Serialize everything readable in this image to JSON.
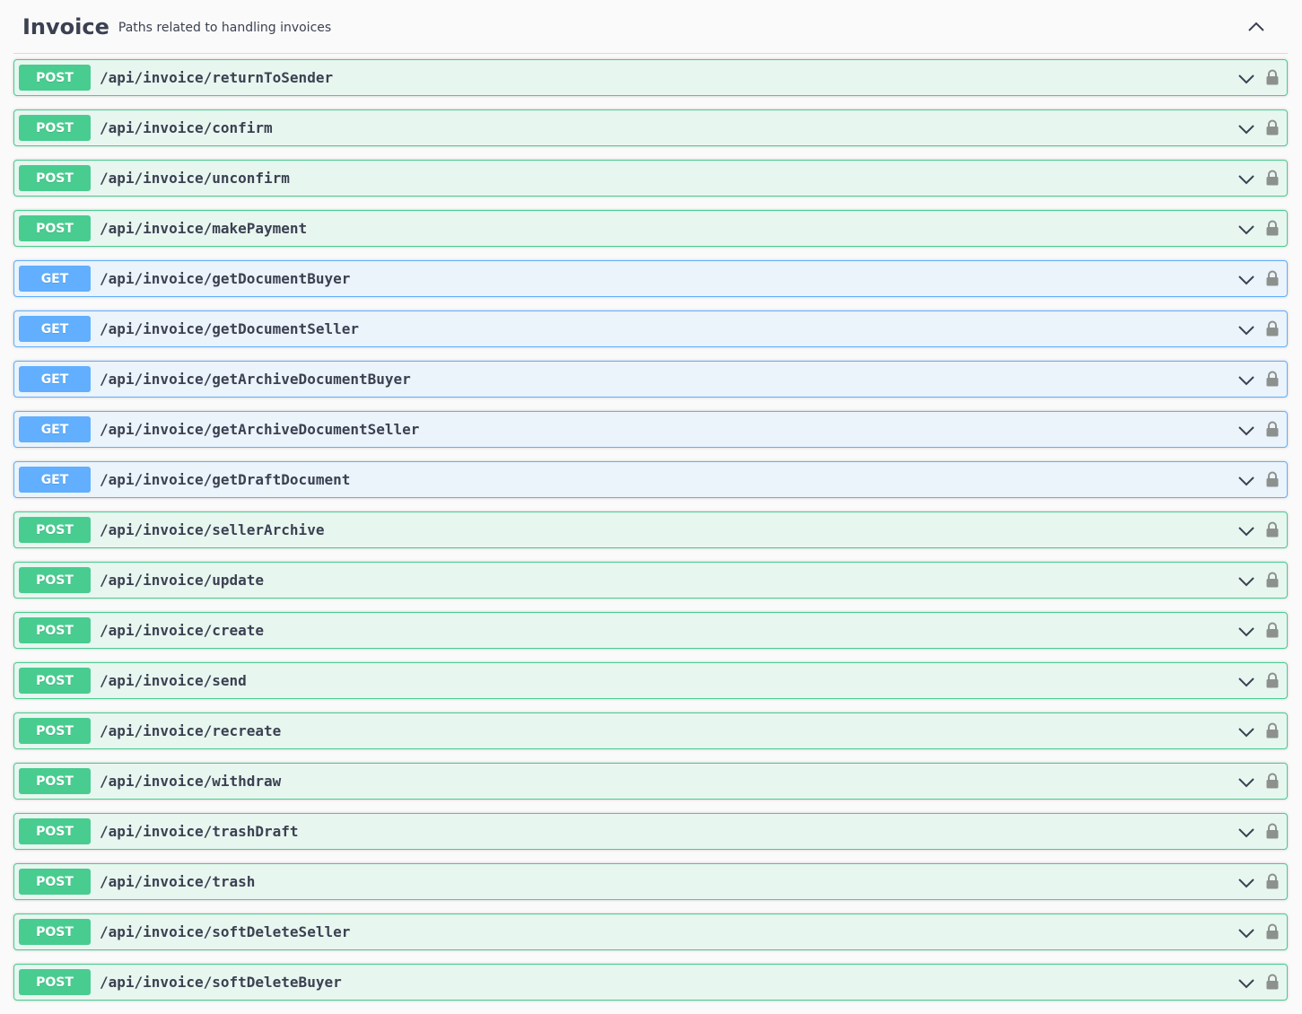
{
  "tag": {
    "title": "Invoice",
    "description": "Paths related to handling invoices"
  },
  "operations": [
    {
      "method": "POST",
      "path": "/api/invoice/returnToSender"
    },
    {
      "method": "POST",
      "path": "/api/invoice/confirm"
    },
    {
      "method": "POST",
      "path": "/api/invoice/unconfirm"
    },
    {
      "method": "POST",
      "path": "/api/invoice/makePayment"
    },
    {
      "method": "GET",
      "path": "/api/invoice/getDocumentBuyer"
    },
    {
      "method": "GET",
      "path": "/api/invoice/getDocumentSeller"
    },
    {
      "method": "GET",
      "path": "/api/invoice/getArchiveDocumentBuyer"
    },
    {
      "method": "GET",
      "path": "/api/invoice/getArchiveDocumentSeller"
    },
    {
      "method": "GET",
      "path": "/api/invoice/getDraftDocument"
    },
    {
      "method": "POST",
      "path": "/api/invoice/sellerArchive"
    },
    {
      "method": "POST",
      "path": "/api/invoice/update"
    },
    {
      "method": "POST",
      "path": "/api/invoice/create"
    },
    {
      "method": "POST",
      "path": "/api/invoice/send"
    },
    {
      "method": "POST",
      "path": "/api/invoice/recreate"
    },
    {
      "method": "POST",
      "path": "/api/invoice/withdraw"
    },
    {
      "method": "POST",
      "path": "/api/invoice/trashDraft"
    },
    {
      "method": "POST",
      "path": "/api/invoice/trash"
    },
    {
      "method": "POST",
      "path": "/api/invoice/softDeleteSeller"
    },
    {
      "method": "POST",
      "path": "/api/invoice/softDeleteBuyer"
    }
  ],
  "icons": {
    "collapse": "chevron-up-icon",
    "expand": "chevron-down-icon",
    "lock": "lock-icon"
  },
  "colors": {
    "post": "#49cc90",
    "post_bg": "#e8f6f0",
    "get": "#61affe",
    "get_bg": "#ebf3fb",
    "text": "#3b4151",
    "icon": "#8d918d"
  }
}
